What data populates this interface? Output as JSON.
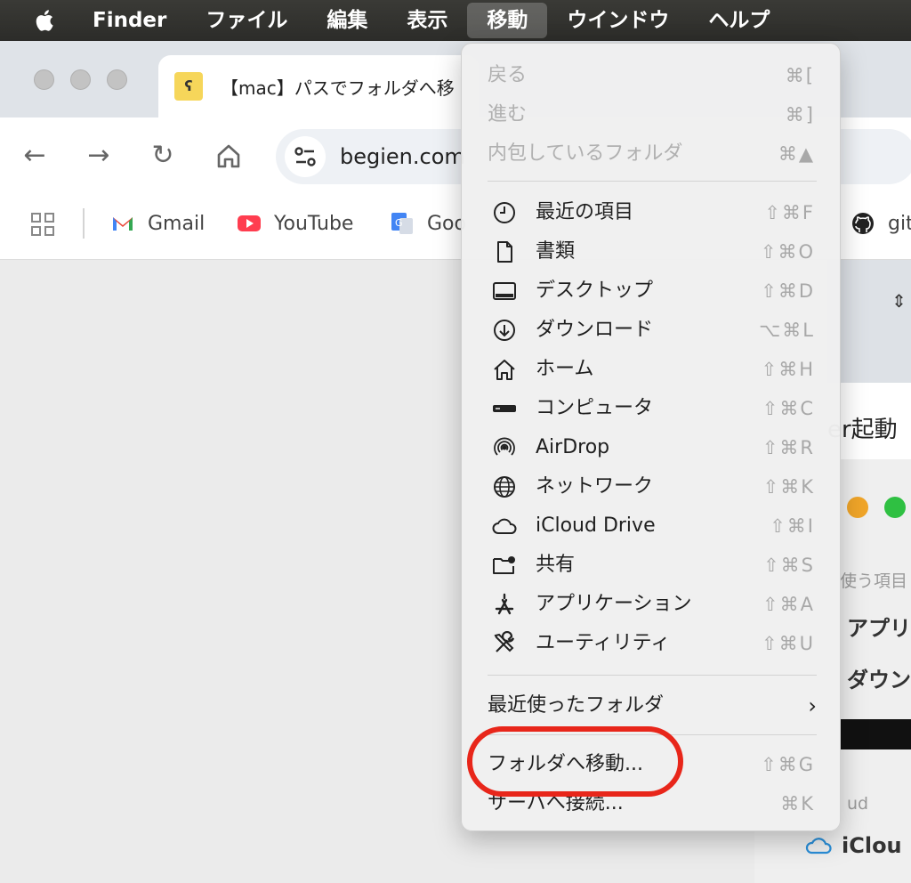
{
  "menubar": {
    "items": [
      "Finder",
      "ファイル",
      "編集",
      "表示",
      "移動",
      "ウインドウ",
      "ヘルプ"
    ],
    "active_index": 4
  },
  "browser": {
    "tab_title": "【mac】パスでフォルダへ移",
    "url": "begien.com",
    "bookmarks": [
      "Gmail",
      "YouTube",
      "Goo",
      "git"
    ]
  },
  "background": {
    "text_fragment": "er起動",
    "finder_section": "使う項目",
    "finder_row1": "アプリ",
    "finder_row2": "ダウン",
    "finder_section2": "ud",
    "icloud_label": "iClou"
  },
  "go_menu": {
    "nav": [
      {
        "label": "戻る",
        "shortcut": "⌘[",
        "enabled": false
      },
      {
        "label": "進む",
        "shortcut": "⌘]",
        "enabled": false
      },
      {
        "label": "内包しているフォルダ",
        "shortcut": "⌘▲",
        "enabled": false
      }
    ],
    "places": [
      {
        "label": "最近の項目",
        "shortcut": "⇧⌘F",
        "icon": "clock-icon"
      },
      {
        "label": "書類",
        "shortcut": "⇧⌘O",
        "icon": "document-icon"
      },
      {
        "label": "デスクトップ",
        "shortcut": "⇧⌘D",
        "icon": "desktop-icon"
      },
      {
        "label": "ダウンロード",
        "shortcut": "⌥⌘L",
        "icon": "download-icon"
      },
      {
        "label": "ホーム",
        "shortcut": "⇧⌘H",
        "icon": "home-icon"
      },
      {
        "label": "コンピュータ",
        "shortcut": "⇧⌘C",
        "icon": "computer-icon"
      },
      {
        "label": "AirDrop",
        "shortcut": "⇧⌘R",
        "icon": "airdrop-icon"
      },
      {
        "label": "ネットワーク",
        "shortcut": "⇧⌘K",
        "icon": "network-icon"
      },
      {
        "label": "iCloud Drive",
        "shortcut": "⇧⌘I",
        "icon": "cloud-icon"
      },
      {
        "label": "共有",
        "shortcut": "⇧⌘S",
        "icon": "shared-folder-icon"
      },
      {
        "label": "アプリケーション",
        "shortcut": "⇧⌘A",
        "icon": "applications-icon"
      },
      {
        "label": "ユーティリティ",
        "shortcut": "⇧⌘U",
        "icon": "utilities-icon"
      }
    ],
    "recent_folders": {
      "label": "最近使ったフォルダ",
      "icon": "chevron-right-icon"
    },
    "go_to_folder": {
      "label": "フォルダへ移動...",
      "shortcut": "⇧⌘G"
    },
    "connect_server": {
      "label": "サーバへ接続...",
      "shortcut": "⌘K"
    },
    "highlight_color": "#e8261a"
  }
}
